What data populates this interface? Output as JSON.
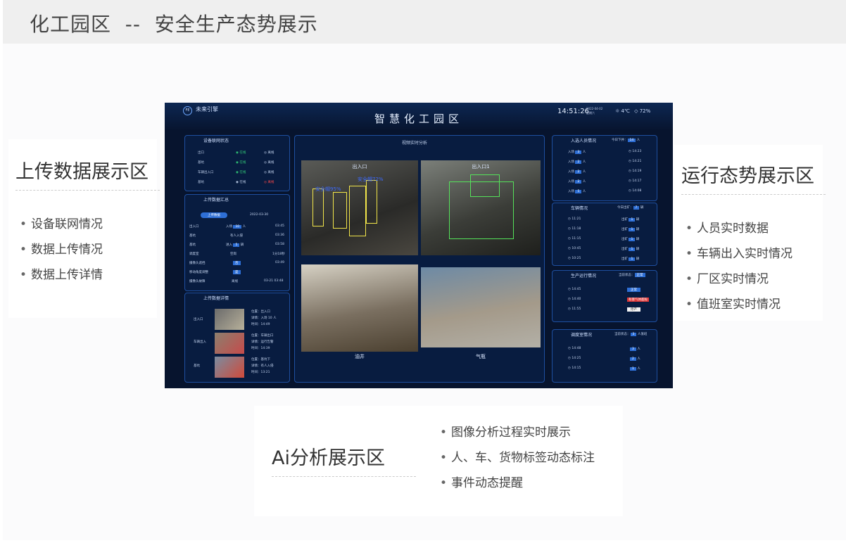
{
  "header": {
    "title": "化工园区  --  安全生产态势展示"
  },
  "left_card": {
    "title": "上传数据展示区",
    "items": [
      "设备联网情况",
      "数据上传情况",
      "数据上传详情"
    ]
  },
  "right_card": {
    "title": "运行态势展示区",
    "items": [
      "人员实时数据",
      "车辆出入实时情况",
      "厂区实时情况",
      "值班室实时情况"
    ]
  },
  "bottom_card": {
    "title": "Ai分析展示区",
    "items": [
      "图像分析过程实时展示",
      "人、车、货物标签动态标注",
      "事件动态提醒"
    ]
  },
  "dashboard": {
    "brand": "未来引擎",
    "logo": "FE",
    "title": "智慧化工园区",
    "time": "14:51:26",
    "date": "2022-04-02",
    "weekday": "星期六",
    "weather": "4℃",
    "humidity": "72%",
    "left_panels": {
      "device": {
        "title": "设备联网状态",
        "rows": [
          {
            "name": "出口",
            "s1": "在线",
            "s2": "离线"
          },
          {
            "name": "基坑",
            "s1": "在线",
            "s2": "离线"
          },
          {
            "name": "车辆出入口",
            "s1": "在线",
            "s2": "离线"
          },
          {
            "name": "基坑",
            "s1": "在线",
            "s2": "离线"
          }
        ]
      },
      "upload": {
        "title": "上传数据汇总",
        "tab": "上传数据",
        "date": "2022-03-30",
        "rows": [
          {
            "name": "出入口",
            "v": "入场",
            "n": "10",
            "u": "人",
            "t": "03:45"
          },
          {
            "name": "基坑",
            "v": "有人入侵",
            "n": "",
            "u": "",
            "t": "03:36"
          },
          {
            "name": "基坑",
            "v": "进入",
            "n": "5",
            "u": "辆",
            "t": "03:58"
          },
          {
            "name": "调度室",
            "v": "空岗",
            "n": "",
            "u": "",
            "t": "1分18秒"
          },
          {
            "name": "摄像头遮挡",
            "v": "否",
            "n": "",
            "u": "",
            "t": "03:49"
          },
          {
            "name": "移动角度调整",
            "v": "是",
            "n": "",
            "u": "",
            "t": ""
          },
          {
            "name": "摄像头故障",
            "v": "离线",
            "n": "",
            "u": "",
            "t": "03-21 03:48"
          }
        ]
      },
      "detail": {
        "title": "上传数据详情",
        "rows": [
          {
            "name": "出入口",
            "l1": "位置：出入口",
            "l2": "详情：入场 10 人",
            "l3": "时间：14:49"
          },
          {
            "name": "车辆出入",
            "l1": "位置：车辆出口",
            "l2": "详情：运行告警",
            "l3": "时间：14:39"
          },
          {
            "name": "基坑",
            "l1": "位置：基坑下",
            "l2": "详情：有人入侵",
            "l3": "时间：13:21"
          }
        ]
      }
    },
    "center": {
      "title": "视频实时分析",
      "videos": [
        "出入口",
        "出入口1",
        "油井",
        "气瓶"
      ],
      "overlay": [
        "安全帽72%",
        "安全帽95%"
      ]
    },
    "right_panels": {
      "people": {
        "title": "入选人员情况",
        "today_label": "今日下井：",
        "today": "14",
        "unit": "人",
        "rows": [
          {
            "a": "入场",
            "n": "3",
            "u": "人",
            "t": "14:23"
          },
          {
            "a": "入场",
            "n": "2",
            "u": "人",
            "t": "14:21"
          },
          {
            "a": "入场",
            "n": "2",
            "u": "人",
            "t": "14:19"
          },
          {
            "a": "入场",
            "n": "2",
            "u": "人",
            "t": "14:17"
          },
          {
            "a": "入场",
            "n": "5",
            "u": "人",
            "t": "14:08"
          }
        ]
      },
      "vehicles": {
        "title": "车辆情况",
        "today_label": "今日出矿：",
        "today": "7",
        "unit": "辆",
        "rows": [
          {
            "t": "11:21",
            "a": "出矿",
            "n": "1",
            "u": "辆"
          },
          {
            "t": "11:18",
            "a": "出矿",
            "n": "1",
            "u": "辆"
          },
          {
            "t": "11:15",
            "a": "出矿",
            "n": "1",
            "u": "辆"
          },
          {
            "t": "10:45",
            "a": "出矿",
            "n": "1",
            "u": "辆"
          },
          {
            "t": "10:25",
            "a": "出矿",
            "n": "1",
            "u": "辆"
          }
        ]
      },
      "production": {
        "title": "生产运行情况",
        "status_label": "当前状态：",
        "status": "正常",
        "rows": [
          {
            "t": "14:45",
            "s": "正常",
            "c": "#2e6fd6"
          },
          {
            "t": "14:40",
            "s": "有害气体超标",
            "c": "#e03a3a"
          },
          {
            "t": "11:55",
            "s": "停产",
            "c": "#f2f2f2"
          }
        ]
      },
      "dispatch": {
        "title": "调度室情况",
        "status_label": "当前状态：",
        "count": "3",
        "status": "人值班",
        "rows": [
          {
            "t": "14:48",
            "n": "3",
            "u": "人"
          },
          {
            "t": "14:25",
            "n": "2",
            "u": "人"
          },
          {
            "t": "14:15",
            "n": "1",
            "u": "人"
          }
        ]
      }
    }
  }
}
